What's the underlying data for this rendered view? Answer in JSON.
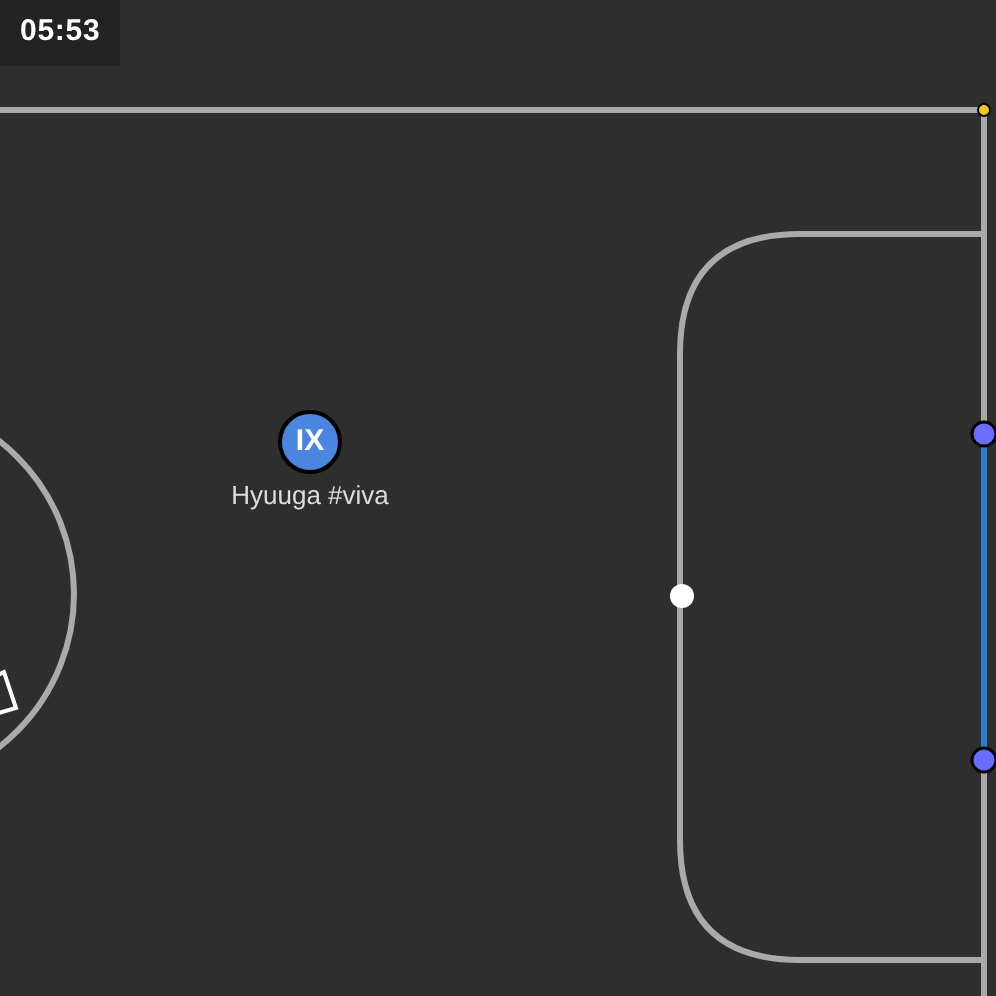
{
  "timer": "05:53",
  "players": [
    {
      "avatar": "IX",
      "name": "Hyuuga #viva",
      "color": "#4a86e0"
    }
  ]
}
